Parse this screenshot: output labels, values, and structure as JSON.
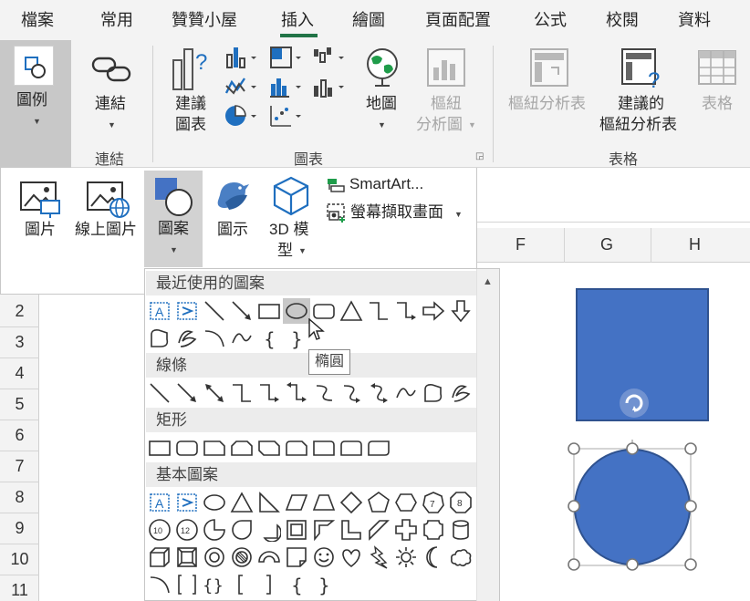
{
  "menu": {
    "tabs": [
      "檔案",
      "常用",
      "贊贊小屋",
      "插入",
      "繪圖",
      "頁面配置",
      "公式",
      "校閱",
      "資料"
    ],
    "active_tab": "插入"
  },
  "ribbon": {
    "illustrations_label": "圖例",
    "links_label": "連結",
    "links_group": "連結",
    "recommended_charts": [
      "建議",
      "圖表"
    ],
    "maps_label": "地圖",
    "pivot_chart": [
      "樞紐",
      "分析圖"
    ],
    "charts_group": "圖表",
    "pivot_table": "樞紐分析表",
    "recommended_pivot": [
      "建議的",
      "樞紐分析表"
    ],
    "table_label": "表格",
    "tables_group": "表格"
  },
  "illustrations": {
    "pictures": "圖片",
    "online_pictures": "線上圖片",
    "shapes": "圖案",
    "icons": "圖示",
    "models_3d": [
      "3D 模",
      "型"
    ],
    "smartart": "SmartArt...",
    "screenshot": "螢幕擷取畫面"
  },
  "gallery": {
    "categories": [
      "最近使用的圖案",
      "線條",
      "矩形",
      "基本圖案"
    ],
    "tooltip": "橢圓"
  },
  "sheet": {
    "columns": [
      "F",
      "G",
      "H"
    ],
    "rows": [
      "2",
      "3",
      "4",
      "5",
      "6",
      "7",
      "8",
      "9",
      "10",
      "11"
    ]
  },
  "colors": {
    "accent_green": "#217346",
    "shape_fill": "#4472c4",
    "shape_outline": "#2f528f",
    "gallery_icon_blue": "#1f6fbf"
  }
}
